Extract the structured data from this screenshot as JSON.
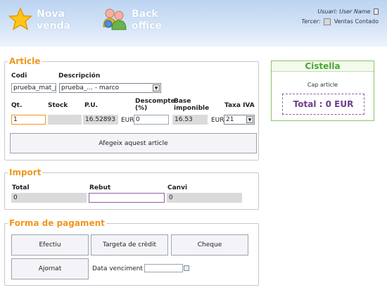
{
  "header": {
    "nav_new_sale": "Nova\nvenda",
    "nav_back_office": "Back\noffice",
    "user_label": "Usuari:",
    "user_value": "User Name",
    "third_party_label": "Tercer:",
    "third_party_value": "Ventas Contado"
  },
  "article": {
    "legend": "Article",
    "code_label": "Codi",
    "code_value": "prueba_mat_p",
    "description_label": "Descripción",
    "description_value": "prueba_... - marco",
    "qty_label": "Qt.",
    "qty_value": "1",
    "stock_label": "Stock",
    "stock_value": "",
    "unit_price_label": "P.U.",
    "unit_price_value": "16.52893",
    "unit_price_currency": "EUR",
    "discount_label": "Descompte (%)",
    "discount_value": "0",
    "tax_base_label": "Base imponible",
    "tax_base_value": "16.53",
    "tax_base_currency": "EUR",
    "vat_label": "Taxa IVA",
    "vat_value": "21",
    "add_button": "Afegeix aquest article"
  },
  "import": {
    "legend": "Import",
    "total_label": "Total",
    "total_value": "0",
    "received_label": "Rebut",
    "received_value": "",
    "change_label": "Canvi",
    "change_value": "0"
  },
  "payment": {
    "legend": "Forma de pagament",
    "cash_button": "Efectiu",
    "card_button": "Targeta de crèdit",
    "cheque_button": "Cheque",
    "defer_button": "Ajornat",
    "due_date_label": "Data venciment :",
    "due_date_value": ""
  },
  "cart": {
    "title": "Cistella",
    "empty_text": "Cap article",
    "total_text": "Total : 0 EUR"
  },
  "colors": {
    "legend": "#f0961e",
    "cart_title": "#4aa534",
    "cart_total": "#6b3e8f"
  }
}
